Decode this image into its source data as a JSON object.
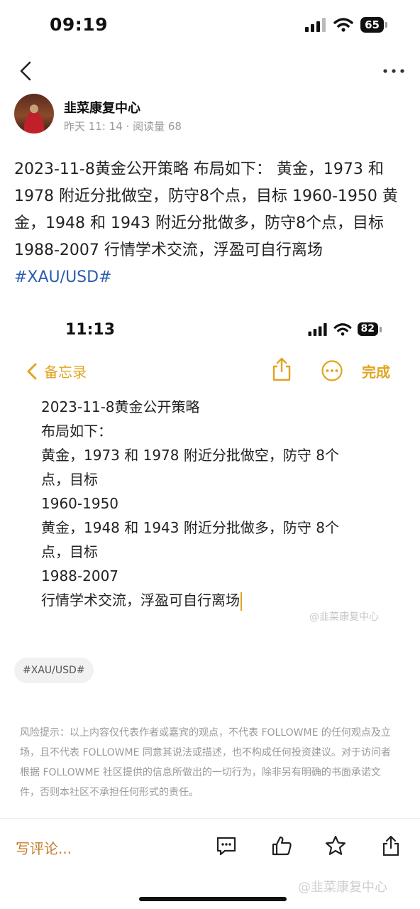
{
  "status_bar": {
    "time": "09:19",
    "battery": "65"
  },
  "author": {
    "name": "韭菜康复中心",
    "meta": "昨天 11: 14 · 阅读量 68"
  },
  "post": {
    "text": "2023-11-8黄金公开策略 布局如下： 黄金，1973 和 1978 附近分批做空，防守8个点，目标 1960-1950 黄金，1948 和 1943 附近分批做多，防守8个点，目标 1988-2007 行情学术交流，浮盈可自行离场",
    "hashtag": "#XAU/USD#"
  },
  "screenshot": {
    "time": "11:13",
    "battery": "82",
    "back_label": "备忘录",
    "done_label": "完成",
    "lines": [
      "2023-11-8黄金公开策略",
      "布局如下：",
      "黄金，1973 和 1978 附近分批做空，防守 8个",
      "点，目标",
      "1960-1950",
      "黄金，1948 和 1943 附近分批做多，防守 8个",
      "点，目标",
      "1988-2007",
      "行情学术交流，浮盈可自行离场"
    ],
    "watermark": "@韭菜康复中心"
  },
  "tag_chip": "#XAU/USD#",
  "disclaimer": "风险提示：以上内容仅代表作者或嘉宾的观点，不代表 FOLLOWME 的任何观点及立场，且不代表 FOLLOWME 同意其说法或描述，也不构成任何投资建议。对于访问者根据 FOLLOWME 社区提供的信息所做出的一切行为，除非另有明确的书面承诺文件，否则本社区不承担任何形式的责任。",
  "bottom_bar": {
    "comment_placeholder": "写评论...",
    "watermark": "@韭菜康复中心"
  },
  "colors": {
    "accent": "#c47f2c",
    "notes_yellow": "#e0a420",
    "link": "#2a5db0"
  }
}
